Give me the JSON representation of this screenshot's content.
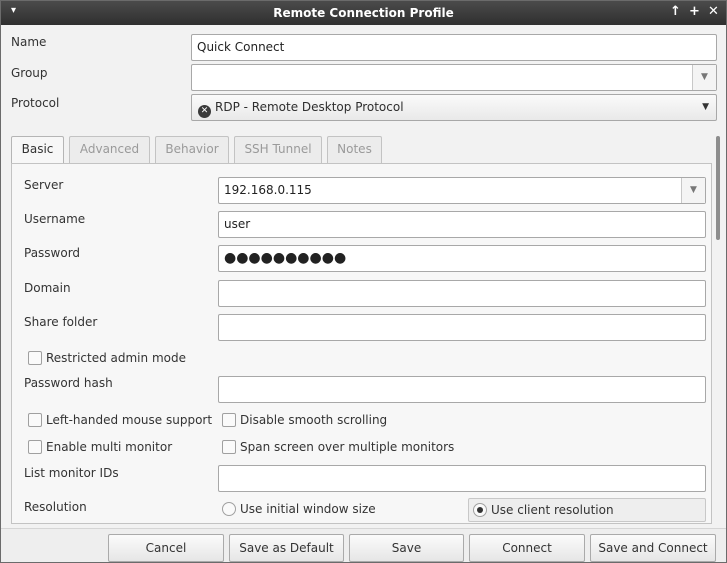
{
  "window": {
    "title": "Remote Connection Profile",
    "menu_glyph": "▾",
    "minimize_glyph": "+",
    "pin_glyph": "↑",
    "close_glyph": "✕"
  },
  "profile": {
    "name_label": "Name",
    "name_value": "Quick Connect",
    "group_label": "Group",
    "group_value": "",
    "protocol_label": "Protocol",
    "protocol_value": "RDP - Remote Desktop Protocol",
    "protocol_icon": "rdp-icon"
  },
  "tabs": [
    {
      "label": "Basic",
      "active": true
    },
    {
      "label": "Advanced",
      "active": false
    },
    {
      "label": "Behavior",
      "active": false
    },
    {
      "label": "SSH Tunnel",
      "active": false
    },
    {
      "label": "Notes",
      "active": false
    }
  ],
  "basic": {
    "server_label": "Server",
    "server_value": "192.168.0.115",
    "username_label": "Username",
    "username_value": "user",
    "password_label": "Password",
    "password_value": "●●●●●●●●●●",
    "domain_label": "Domain",
    "domain_value": "",
    "share_folder_label": "Share folder",
    "share_folder_value": "",
    "restricted_admin_label": "Restricted admin mode",
    "password_hash_label": "Password hash",
    "password_hash_value": "",
    "left_handed_label": "Left-handed mouse support",
    "disable_smooth_label": "Disable smooth scrolling",
    "multi_monitor_label": "Enable multi monitor",
    "span_screen_label": "Span screen over multiple monitors",
    "monitor_ids_label": "List monitor IDs",
    "monitor_ids_value": "",
    "resolution_label": "Resolution",
    "resolution_option_initial": "Use initial window size",
    "resolution_option_client": "Use client resolution",
    "resolution_selected": "Use client resolution"
  },
  "buttons": {
    "cancel": "Cancel",
    "save_default": "Save as Default",
    "save": "Save",
    "connect": "Connect",
    "save_connect": "Save and Connect"
  }
}
